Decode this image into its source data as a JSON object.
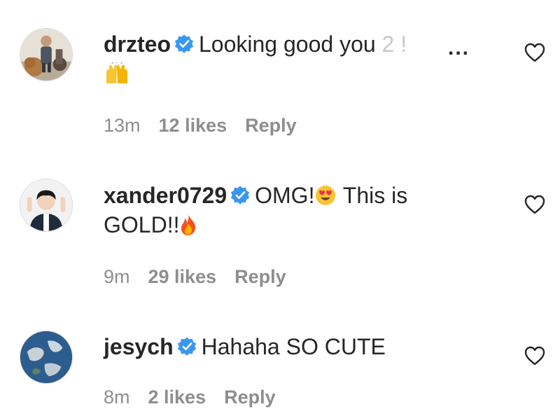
{
  "comments": [
    {
      "username": "drzteo",
      "text": "Looking good you ",
      "text_faded": "2 !",
      "more": "...",
      "time": "13m",
      "likes": "12 likes",
      "reply": "Reply",
      "emoji": [
        "raised-hands-icon"
      ]
    },
    {
      "username": "xander0729",
      "text_part1": "OMG!",
      "text_part2": " This is",
      "text_line2": "GOLD!!",
      "time": "9m",
      "likes": "29 likes",
      "reply": "Reply",
      "emoji": [
        "heart-eyes-icon",
        "fire-icon"
      ]
    },
    {
      "username": "jesych",
      "text": "Hahaha SO CUTE",
      "time": "8m",
      "likes": "2 likes",
      "reply": "Reply"
    }
  ],
  "colors": {
    "text": "#262626",
    "meta": "#8e8e8e",
    "verified": "#3897f0"
  }
}
